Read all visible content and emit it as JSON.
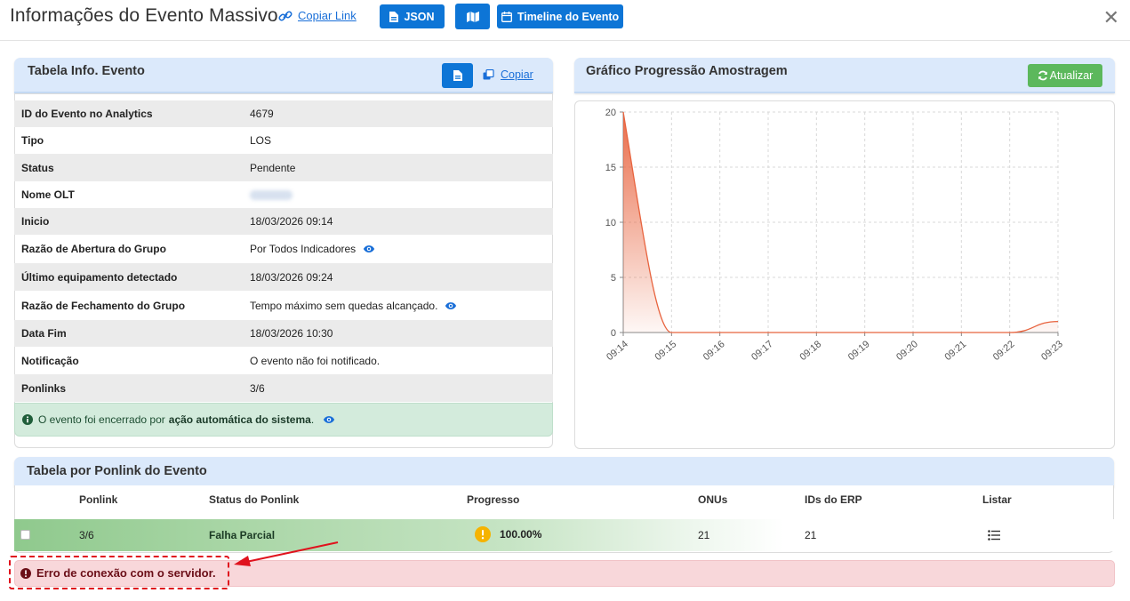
{
  "header": {
    "title": "Informações do Evento Massivo",
    "copy_link_label": "Copiar Link",
    "json_button_label": "JSON",
    "map_button_icon": "map-icon",
    "timeline_button_label": "Timeline do Evento",
    "close_icon": "close-icon"
  },
  "info_panel": {
    "title": "Tabela Info. Evento",
    "copy_label": "Copiar",
    "rows": [
      {
        "label": "ID do Evento no Analytics",
        "value": "4679"
      },
      {
        "label": "Tipo",
        "value": "LOS"
      },
      {
        "label": "Status",
        "value": "Pendente"
      },
      {
        "label": "Nome OLT",
        "value": ""
      },
      {
        "label": "Inicio",
        "value": "18/03/2026 09:14"
      },
      {
        "label": "Razão de Abertura do Grupo",
        "value": "Por Todos Indicadores"
      },
      {
        "label": "Último equipamento detectado",
        "value": "18/03/2026 09:24"
      },
      {
        "label": "Razão de Fechamento do Grupo",
        "value": "Tempo máximo sem quedas alcançado."
      },
      {
        "label": "Data Fim",
        "value": "18/03/2026 10:30"
      },
      {
        "label": "Notificação",
        "value": "O evento não foi notificado."
      },
      {
        "label": "Ponlinks",
        "value": "3/6"
      }
    ],
    "alert_prefix": "O evento foi encerrado por",
    "alert_bold": "ação automática do sistema",
    "alert_suffix": "."
  },
  "chart_panel": {
    "title": "Gráfico Progressão Amostragem",
    "refresh_label": "Atualizar"
  },
  "chart_data": {
    "type": "area",
    "title": "",
    "xlabel": "",
    "ylabel": "",
    "x": [
      "09:14",
      "09:15",
      "09:16",
      "09:17",
      "09:18",
      "09:19",
      "09:20",
      "09:21",
      "09:22",
      "09:23"
    ],
    "y": [
      20,
      0,
      0,
      0,
      0,
      0,
      0,
      0,
      0,
      1
    ],
    "yticks": [
      0,
      5,
      10,
      15,
      20
    ],
    "ylim": [
      0,
      20
    ],
    "grid": true,
    "legend": "none",
    "color": "#e8643f"
  },
  "ponlink_panel": {
    "title": "Tabela por Ponlink do Evento",
    "columns": [
      "Ponlink",
      "Status do Ponlink",
      "Progresso",
      "ONUs",
      "IDs do ERP",
      "Listar"
    ],
    "rows": [
      {
        "ponlink": "3/6",
        "status": "Falha Parcial",
        "progress": "100.00%",
        "onus": "21",
        "erp_ids": "21"
      }
    ]
  },
  "error_alert": {
    "text": "Erro de conexão com o servidor."
  },
  "colors": {
    "primary": "#0d75d6",
    "success": "#5cb85c",
    "danger_text": "#6b0f18",
    "chart_line": "#e8643f"
  }
}
